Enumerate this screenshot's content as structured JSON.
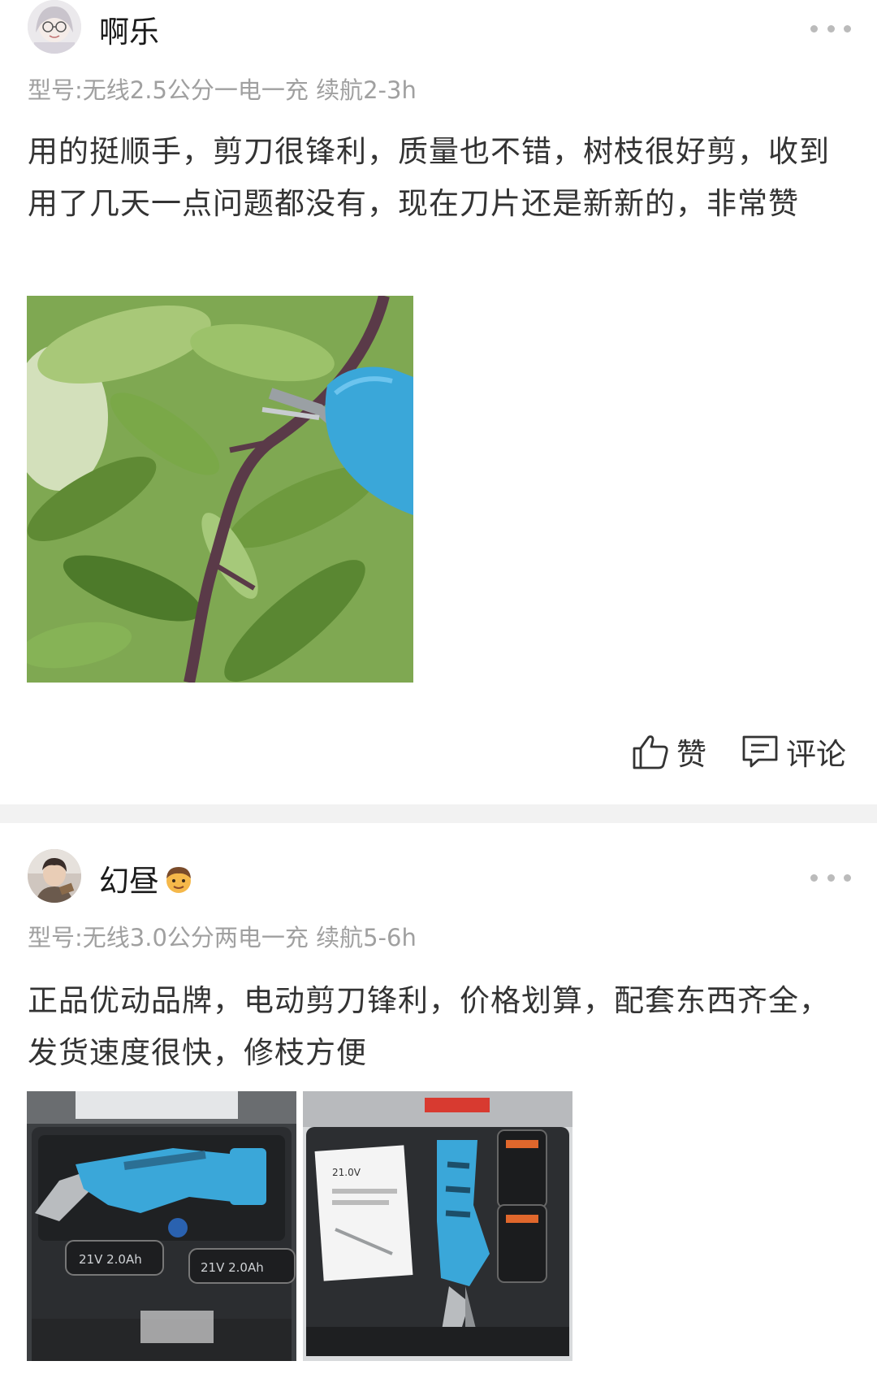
{
  "reviews": [
    {
      "username": "啊乐",
      "model": "型号:无线2.5公分一电一充  续航2-3h",
      "content": "用的挺顺手，剪刀很锋利，质量也不错，树枝很好剪，收到用了几天一点问题都没有，现在刀片还是新新的，非常赞",
      "photos": [
        "pruning-shears-on-branch-photo"
      ]
    },
    {
      "username": "幻昼",
      "username_emoji": "man-emoji",
      "model": "型号:无线3.0公分两电一充  续航5-6h",
      "content": "正品优动品牌，电动剪刀锋利，价格划算，配套东西齐全，发货速度很快，修枝方便",
      "photos": [
        "shears-in-case-with-batteries-photo",
        "shears-case-open-photo"
      ],
      "photo_texts": {
        "battery_left": "21V 2.0Ah",
        "battery_right": "21V 2.0Ah",
        "manual": "21.0V"
      }
    }
  ],
  "actions": {
    "like_label": "赞",
    "comment_label": "评论"
  },
  "colors": {
    "muted_text": "#a0a0a0",
    "divider": "#f2f2f2",
    "tool_blue": "#3aa7d9"
  }
}
